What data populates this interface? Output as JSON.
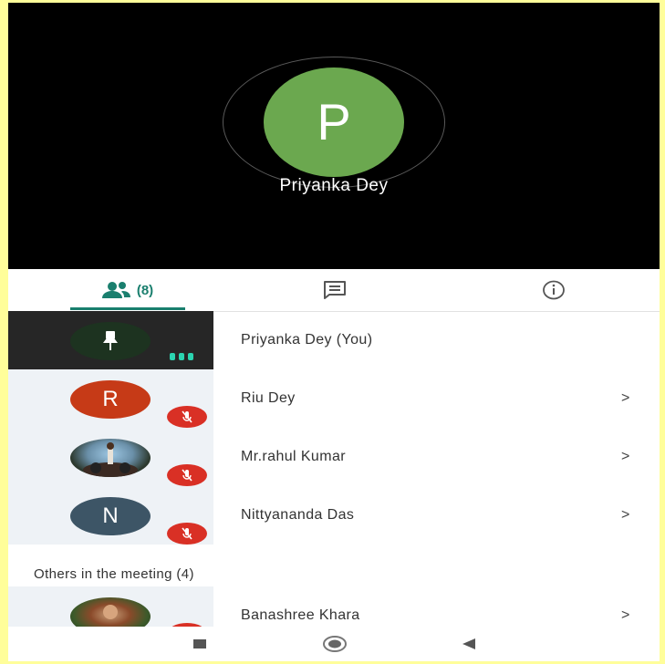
{
  "video": {
    "speaker_initial": "P",
    "speaker_name": "Priyanka Dey",
    "avatar_color": "#6ba84f"
  },
  "tabs": [
    {
      "icon": "people-icon",
      "count": "(8)",
      "active": true
    },
    {
      "icon": "chat-icon"
    },
    {
      "icon": "info-icon"
    }
  ],
  "participants": [
    {
      "name": "Priyanka Dey (You)",
      "icon": "pin-icon",
      "status": "speaking"
    },
    {
      "initial": "R",
      "name": "Riu Dey",
      "chevron": ">",
      "avatar_color": "#c63a17",
      "status": "muted"
    },
    {
      "name": "Mr.rahul Kumar",
      "chevron": ">",
      "photo": true,
      "status": "muted"
    },
    {
      "initial": "N",
      "name": "Nittyananda Das",
      "chevron": ">",
      "avatar_color": "#3d5566",
      "status": "muted"
    }
  ],
  "others": {
    "label": "Others in the meeting (4)",
    "items": [
      {
        "name": "Banashree Khara",
        "chevron": ">",
        "photo": true
      }
    ]
  },
  "navbar": {
    "items": [
      "recents-icon",
      "home-icon",
      "back-icon"
    ]
  }
}
